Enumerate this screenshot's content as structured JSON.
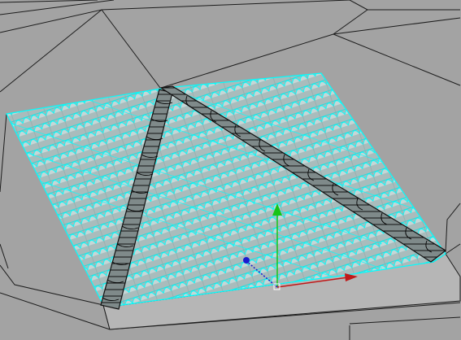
{
  "viewport": {
    "background": "#a3a3a3",
    "wire_color": "#1c1c1c",
    "tile_fill": "#a9bcbc",
    "tile_wire": "#00ffff",
    "ridge_fill": "#7f8a8a",
    "ridge_wire": "#111111",
    "slab_fill": "#b6b6b6"
  },
  "gizmo": {
    "y_axis_color": "#16c416",
    "x_axis_color": "#c01818",
    "z_axis_color": "#1a1ad0",
    "pivot_icon": "move-pivot-square"
  },
  "objects": {
    "roof": "roof-tile-mesh",
    "hip_left": "hip-ridge-left",
    "hip_right": "hip-ridge-right",
    "slab": "roof-base-slab"
  }
}
